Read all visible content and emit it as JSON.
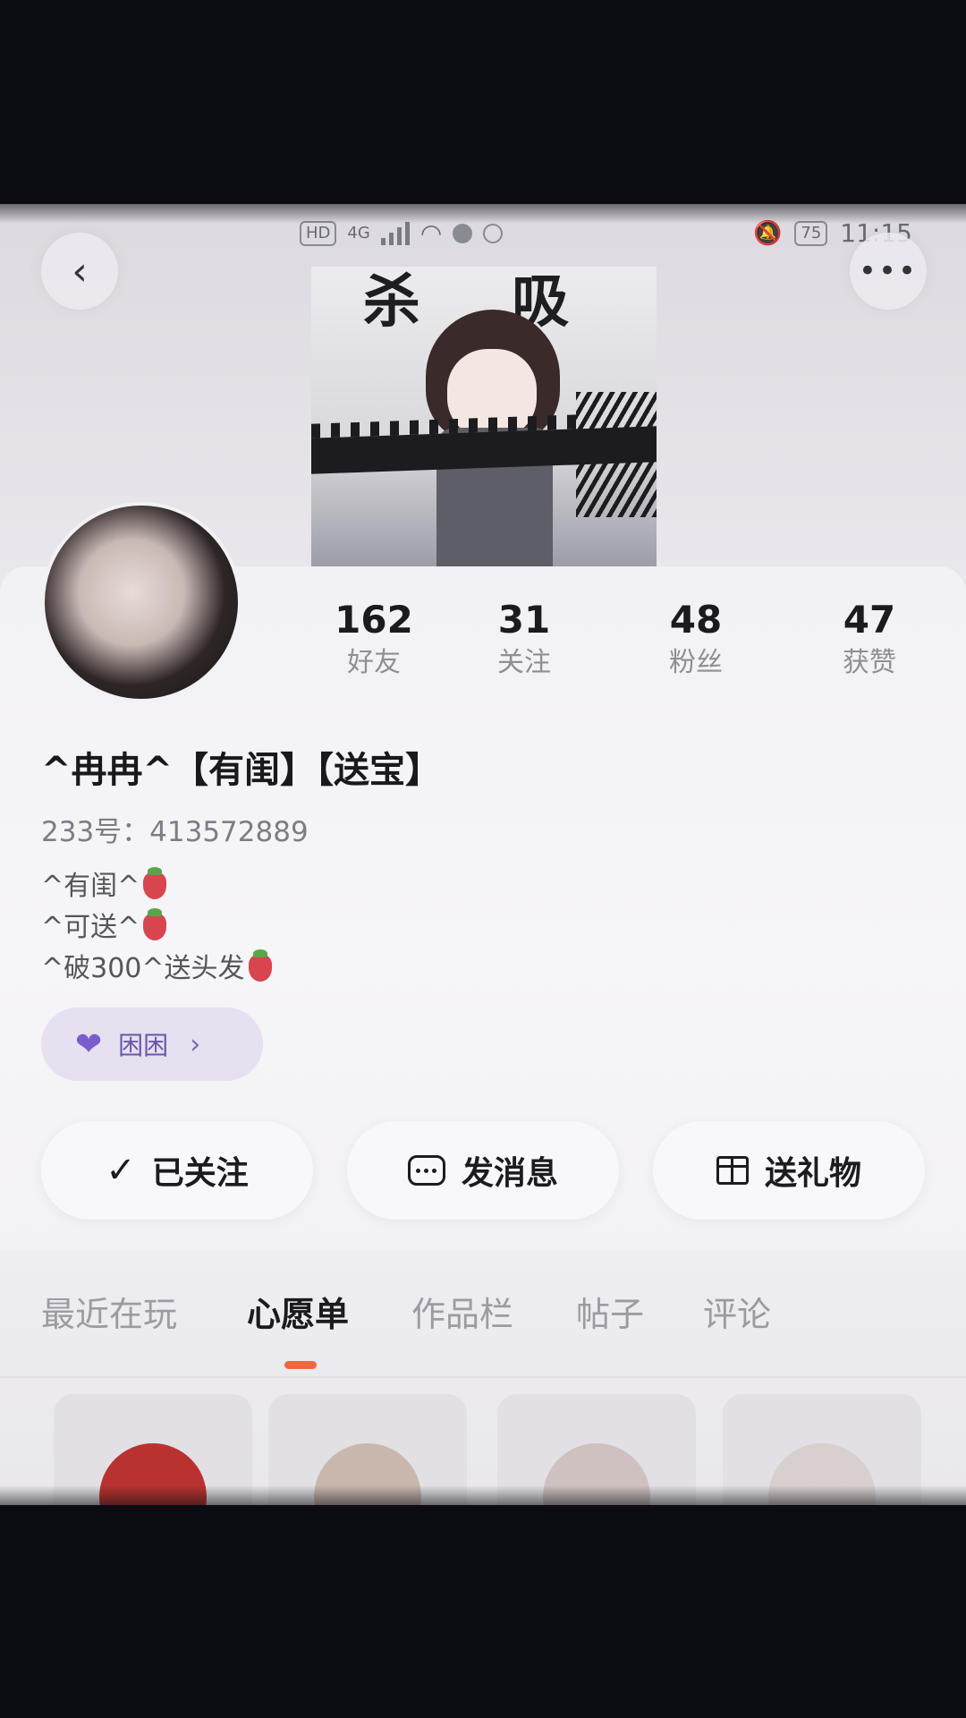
{
  "status_bar": {
    "network_chip": "HD",
    "signal": "4G",
    "battery": "75",
    "time": "11:15"
  },
  "header": {
    "back_icon": "chevron-left-icon",
    "more_icon": "more-dots-icon",
    "banner_title": "杀 吸"
  },
  "profile": {
    "stats": [
      {
        "value": "162",
        "label": "好友"
      },
      {
        "value": "31",
        "label": "关注"
      },
      {
        "value": "48",
        "label": "粉丝"
      },
      {
        "value": "47",
        "label": "获赞"
      }
    ],
    "name": "^冉冉^【有闺】【送宝】",
    "id_text": "233号：413572889",
    "bio": [
      "^有闺^",
      "^可送^",
      "^破300^送头发"
    ],
    "tag": {
      "label": "困困",
      "icon": "heart-icon",
      "color": "#7a5ccf"
    }
  },
  "actions": [
    {
      "label": "已关注",
      "icon": "check-icon"
    },
    {
      "label": "发消息",
      "icon": "chat-icon"
    },
    {
      "label": "送礼物",
      "icon": "gift-icon"
    }
  ],
  "tabs": [
    {
      "label": "最近在玩"
    },
    {
      "label": "心愿单",
      "active": true
    },
    {
      "label": "作品栏"
    },
    {
      "label": "帖子"
    },
    {
      "label": "评论"
    }
  ],
  "accent_color": "#ee6a3c"
}
